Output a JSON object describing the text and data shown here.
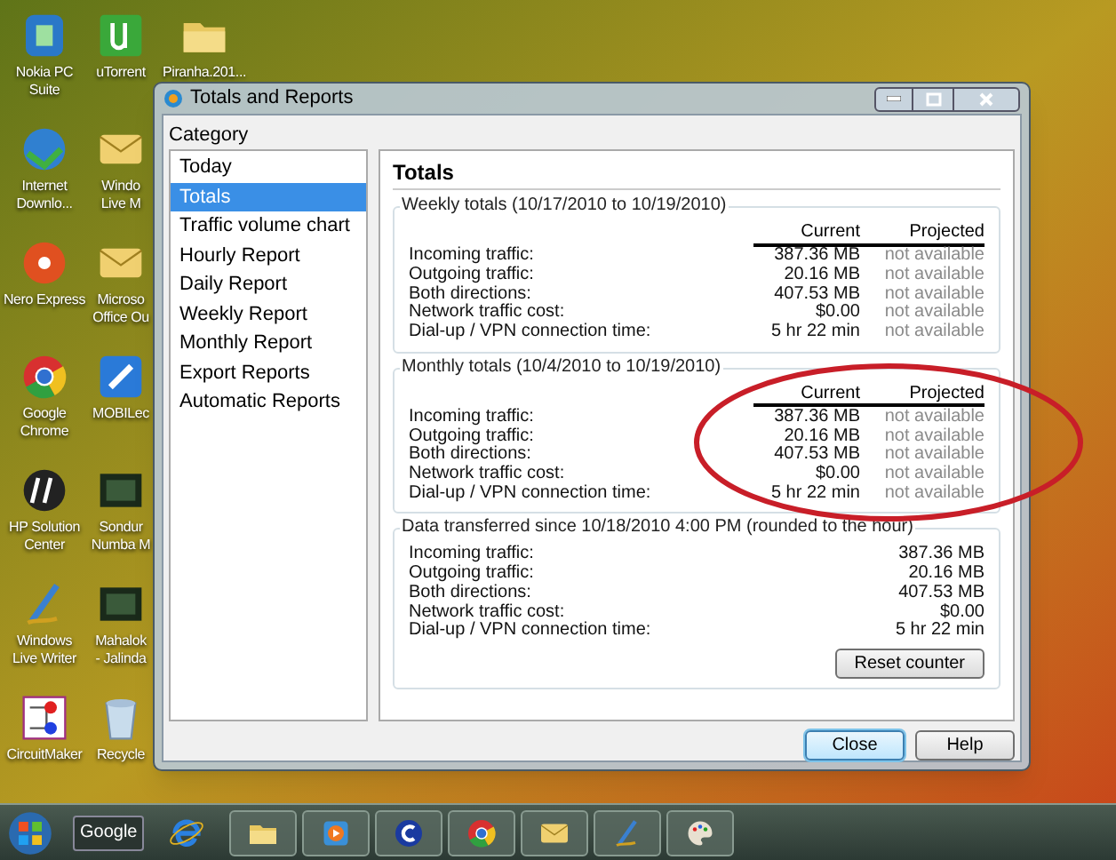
{
  "desktop": {
    "columns": [
      [
        {
          "lines": [
            "Nokia PC",
            "Suite"
          ],
          "kind": "phone"
        },
        {
          "lines": [
            "Internet",
            "Downlo..."
          ],
          "kind": "globe"
        },
        {
          "lines": [
            "Nero Express"
          ],
          "kind": "disc"
        },
        {
          "lines": [
            "Google",
            "Chrome"
          ],
          "kind": "chrome"
        },
        {
          "lines": [
            "HP Solution",
            "Center"
          ],
          "kind": "hp"
        },
        {
          "lines": [
            "Windows",
            "Live Writer"
          ],
          "kind": "pen"
        },
        {
          "lines": [
            "CircuitMaker"
          ],
          "kind": "circuit"
        }
      ],
      [
        {
          "lines": [
            "uTorrent"
          ],
          "kind": "torrent"
        },
        {
          "lines": [
            "Windo",
            "Live M"
          ],
          "kind": "mail"
        },
        {
          "lines": [
            "Microso",
            "Office Ou"
          ],
          "kind": "mail"
        },
        {
          "lines": [
            "MOBILec"
          ],
          "kind": "app"
        },
        {
          "lines": [
            "Sondur",
            "Numba M"
          ],
          "kind": "video"
        },
        {
          "lines": [
            "Mahalok",
            "- Jalinda"
          ],
          "kind": "video"
        },
        {
          "lines": [
            "Recycle"
          ],
          "kind": "bin"
        }
      ],
      [
        {
          "lines": [
            "Piranha.201..."
          ],
          "kind": "folder"
        }
      ]
    ]
  },
  "window": {
    "title": "Totals and Reports",
    "category_label": "Category",
    "categories": [
      {
        "label": "Today",
        "selected": false
      },
      {
        "label": "Totals",
        "selected": true
      },
      {
        "label": "Traffic volume chart",
        "selected": false
      },
      {
        "label": "Hourly Report",
        "selected": false
      },
      {
        "label": "Daily Report",
        "selected": false
      },
      {
        "label": "Weekly Report",
        "selected": false
      },
      {
        "label": "Monthly Report",
        "selected": false
      },
      {
        "label": "Export Reports",
        "selected": false
      },
      {
        "label": "Automatic Reports",
        "selected": false
      }
    ],
    "panel_title": "Totals",
    "groups": [
      {
        "title": "Weekly totals (10/17/2010 to 10/19/2010)",
        "columns": [
          "Current",
          "Projected"
        ],
        "rows": [
          {
            "label": "Incoming traffic:",
            "values": [
              "387.36 MB",
              "not available"
            ]
          },
          {
            "label": "Outgoing traffic:",
            "values": [
              "20.16 MB",
              "not available"
            ]
          },
          {
            "label": "Both directions:",
            "values": [
              "407.53 MB",
              "not available"
            ]
          },
          {
            "label": "Network traffic cost:",
            "values": [
              "$0.00",
              "not available"
            ]
          },
          {
            "label": "Dial-up / VPN connection time:",
            "values": [
              "5 hr 22 min",
              "not available"
            ]
          }
        ]
      },
      {
        "title": "Monthly totals (10/4/2010 to 10/19/2010)",
        "columns": [
          "Current",
          "Projected"
        ],
        "highlighted": true,
        "rows": [
          {
            "label": "Incoming traffic:",
            "values": [
              "387.36 MB",
              "not available"
            ]
          },
          {
            "label": "Outgoing traffic:",
            "values": [
              "20.16 MB",
              "not available"
            ]
          },
          {
            "label": "Both directions:",
            "values": [
              "407.53 MB",
              "not available"
            ]
          },
          {
            "label": "Network traffic cost:",
            "values": [
              "$0.00",
              "not available"
            ]
          },
          {
            "label": "Dial-up / VPN connection time:",
            "values": [
              "5 hr 22 min",
              "not available"
            ]
          }
        ]
      },
      {
        "title": "Data transferred since 10/18/2010 4:00 PM (rounded to the hour)",
        "button": "Reset counter",
        "rows": [
          {
            "label": "Incoming traffic:",
            "values": [
              "387.36 MB"
            ]
          },
          {
            "label": "Outgoing traffic:",
            "values": [
              "20.16 MB"
            ]
          },
          {
            "label": "Both directions:",
            "values": [
              "407.53 MB"
            ]
          },
          {
            "label": "Network traffic cost:",
            "values": [
              "$0.00"
            ]
          },
          {
            "label": "Dial-up / VPN connection time:",
            "values": [
              "5 hr 22 min"
            ]
          }
        ]
      }
    ],
    "buttons": [
      {
        "label": "Close",
        "default": true
      },
      {
        "label": "Help",
        "default": false
      }
    ]
  },
  "taskbar": {
    "items": [
      {
        "kind": "start"
      },
      {
        "kind": "text",
        "label": "Google"
      },
      {
        "kind": "browser"
      },
      {
        "kind": "folder"
      },
      {
        "kind": "media"
      },
      {
        "kind": "letter"
      },
      {
        "kind": "chrome"
      },
      {
        "kind": "mail"
      },
      {
        "kind": "pen"
      },
      {
        "kind": "palette"
      }
    ]
  }
}
